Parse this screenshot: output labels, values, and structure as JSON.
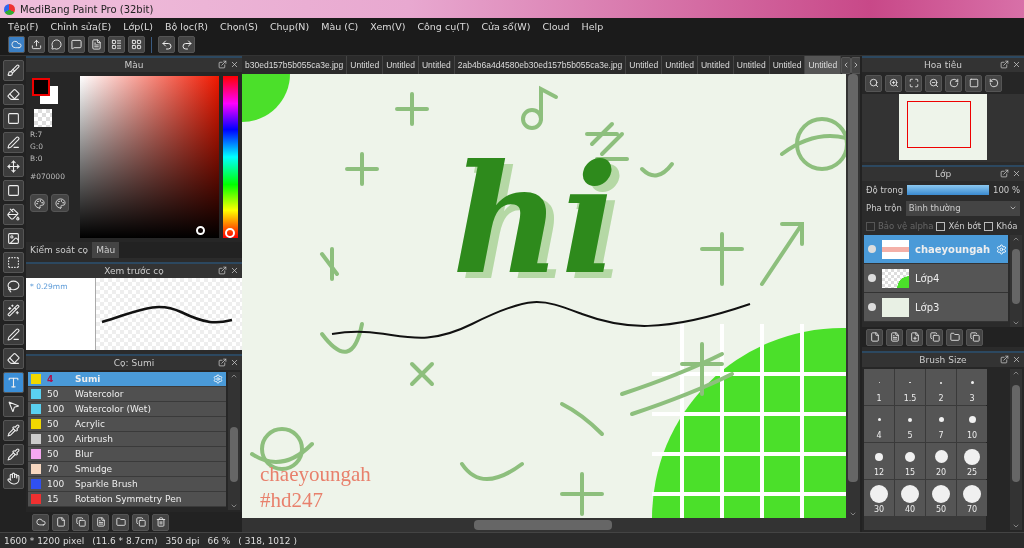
{
  "window": {
    "title": "MediBang Paint Pro (32bit)"
  },
  "menu": [
    "Tệp(F)",
    "Chỉnh sửa(E)",
    "Lớp(L)",
    "Bộ lọc(R)",
    "Chọn(S)",
    "Chụp(N)",
    "Màu (C)",
    "Xem(V)",
    "Công cụ(T)",
    "Cửa sổ(W)",
    "Cloud",
    "Help"
  ],
  "color_panel": {
    "title": "Màu",
    "hue": {
      "level": 0
    },
    "rgb": [
      "R:7",
      "G:0",
      "B:0"
    ],
    "hex": "#070000",
    "tabs": [
      {
        "label": "Kiểm soát cọ",
        "selected": false
      },
      {
        "label": "Màu",
        "selected": true
      }
    ]
  },
  "brush_preview": {
    "title": "Xem trước cọ",
    "size": "* 0.29mm"
  },
  "brush_panel": {
    "title": "Cọ: Sumi",
    "brushes": [
      {
        "size": "4",
        "name": "Sumi",
        "color": "#f0d800",
        "selected": true
      },
      {
        "size": "50",
        "name": "Watercolor",
        "color": "#5ad0f0",
        "selected": false
      },
      {
        "size": "100",
        "name": "Watercolor (Wet)",
        "color": "#5ad0f0",
        "selected": false
      },
      {
        "size": "50",
        "name": "Acrylic",
        "color": "#f0d800",
        "selected": false
      },
      {
        "size": "100",
        "name": "Airbrush",
        "color": "#cccccc",
        "selected": false
      },
      {
        "size": "50",
        "name": "Blur",
        "color": "#f4a8f0",
        "selected": false
      },
      {
        "size": "70",
        "name": "Smudge",
        "color": "#f8d8c0",
        "selected": false
      },
      {
        "size": "100",
        "name": "Sparkle Brush",
        "color": "#3050f0",
        "selected": false
      },
      {
        "size": "15",
        "name": "Rotation Symmetry Pen",
        "color": "#f03030",
        "selected": false
      }
    ]
  },
  "document_tabs": [
    {
      "label": "b30ed157b5b055ca3e.jpg",
      "selected": false
    },
    {
      "label": "Untitled",
      "selected": false
    },
    {
      "label": "Untitled",
      "selected": false
    },
    {
      "label": "Untitled",
      "selected": false
    },
    {
      "label": "2ab4b6a4d4580eb30ed157b5b055ca3e.jpg",
      "selected": false
    },
    {
      "label": "Untitled",
      "selected": false
    },
    {
      "label": "Untitled",
      "selected": false
    },
    {
      "label": "Untitled",
      "selected": false
    },
    {
      "label": "Untitled",
      "selected": false
    },
    {
      "label": "Untitled",
      "selected": false
    },
    {
      "label": "Untitled",
      "selected": true
    }
  ],
  "canvas": {
    "lettering": "hi",
    "signature": [
      "chaeyoungah",
      "#hd247"
    ]
  },
  "navigator": {
    "title": "Hoa tiêu"
  },
  "layers_panel": {
    "title": "Lớp",
    "opacity_label": "Độ trong",
    "opacity": {
      "level": 1
    },
    "opacity_value": "100 %",
    "blend_label": "Pha trộn",
    "blend_value": "Bình thường",
    "options": [
      {
        "label": "Bảo vệ alpha",
        "checked": false,
        "disabled": true
      },
      {
        "label": "Xén bớt",
        "checked": false,
        "disabled": false
      },
      {
        "label": "Khóa",
        "checked": false,
        "disabled": false
      }
    ],
    "layers": [
      {
        "name": "chaeyoungah",
        "kind": "text",
        "selected": true
      },
      {
        "name": "Lớp4",
        "kind": "corner",
        "selected": false
      },
      {
        "name": "Lớp3",
        "kind": "plain",
        "selected": false
      }
    ]
  },
  "brush_size_panel": {
    "title": "Brush Size",
    "sizes": [
      "1",
      "1.5",
      "2",
      "3",
      "4",
      "5",
      "7",
      "10",
      "12",
      "15",
      "20",
      "25",
      "30",
      "40",
      "50",
      "70"
    ]
  },
  "status_bar": {
    "dimensions": "1600 * 1200 pixel",
    "physical": "(11.6 * 8.7cm)",
    "dpi": "350 dpi",
    "zoom": "66 %",
    "cursor": "( 318, 1012 )"
  }
}
